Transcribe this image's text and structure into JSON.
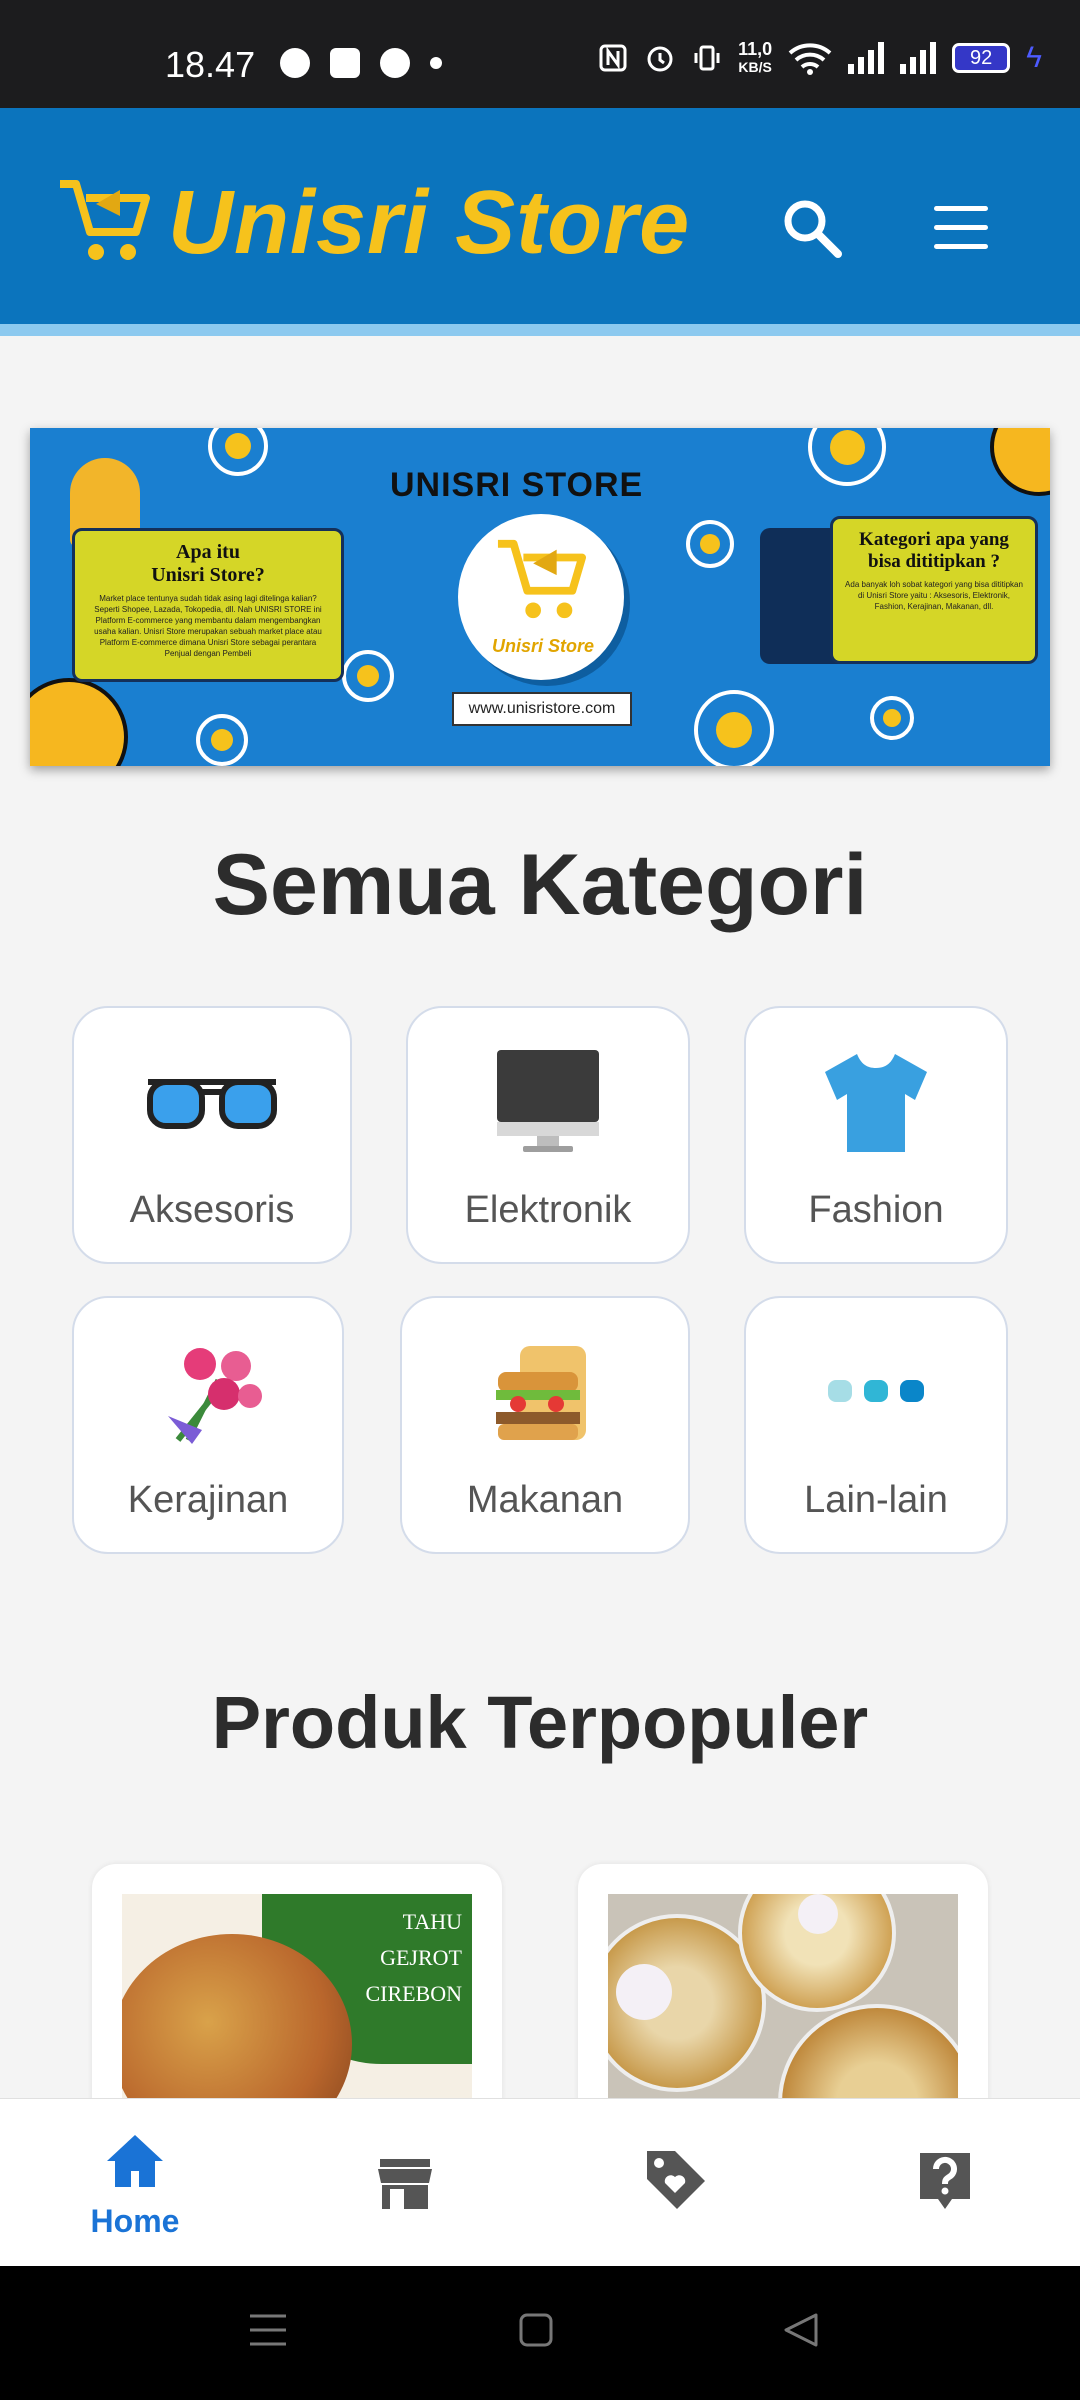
{
  "status_bar": {
    "time": "18.47",
    "net_speed_top": "11,0",
    "net_speed_bottom": "KB/S",
    "battery": "92"
  },
  "header": {
    "brand": "Unisri Store",
    "brand_color": "#f6c21c",
    "bar_color": "#0b74bd",
    "search_icon": "search-icon",
    "menu_icon": "hamburger-menu-icon"
  },
  "banner": {
    "title": "UNISRI STORE",
    "logo_label": "Unisri Store",
    "url": "www.unisristore.com",
    "left_note_title_1": "Apa itu",
    "left_note_title_2": "Unisri Store?",
    "left_note_text": "Market place tentunya sudah tidak asing lagi ditelinga kalian? Seperti Shopee, Lazada, Tokopedia, dll. Nah UNISRI STORE ini Platform E-commerce yang membantu dalam mengembangkan usaha kalian. Unisri Store merupakan sebuah market place atau Platform E-commerce dimana Unisri Store sebagai perantara Penjual dengan Pembeli",
    "right_note_title": "Kategori apa yang bisa dititipkan ?",
    "right_note_text": "Ada banyak loh sobat kategori yang bisa dititipkan di Unisri Store yaitu : Aksesoris, Elektronik, Fashion, Kerajinan, Makanan, dll."
  },
  "categories": {
    "title": "Semua Kategori",
    "items": [
      {
        "label": "Aksesoris",
        "icon": "sunglasses-icon"
      },
      {
        "label": "Elektronik",
        "icon": "monitor-icon"
      },
      {
        "label": "Fashion",
        "icon": "tshirt-icon"
      },
      {
        "label": "Kerajinan",
        "icon": "flower-bouquet-icon"
      },
      {
        "label": "Makanan",
        "icon": "sandwich-icon"
      },
      {
        "label": "Lain-lain",
        "icon": "three-dots-icon"
      }
    ]
  },
  "popular": {
    "title": "Produk Terpopuler",
    "products": [
      {
        "image_text_1": "TAHU",
        "image_text_2": "GEJROT",
        "image_text_3": "CIREBON",
        "icon": "tahu-gejrot-image"
      },
      {
        "icon": "cookie-jars-image"
      }
    ]
  },
  "bottom_nav": {
    "active_color": "#1a73d6",
    "items": [
      {
        "label": "Home",
        "icon": "home-icon",
        "active": true
      },
      {
        "icon": "store-icon"
      },
      {
        "icon": "tag-heart-icon"
      },
      {
        "icon": "help-icon"
      }
    ]
  }
}
